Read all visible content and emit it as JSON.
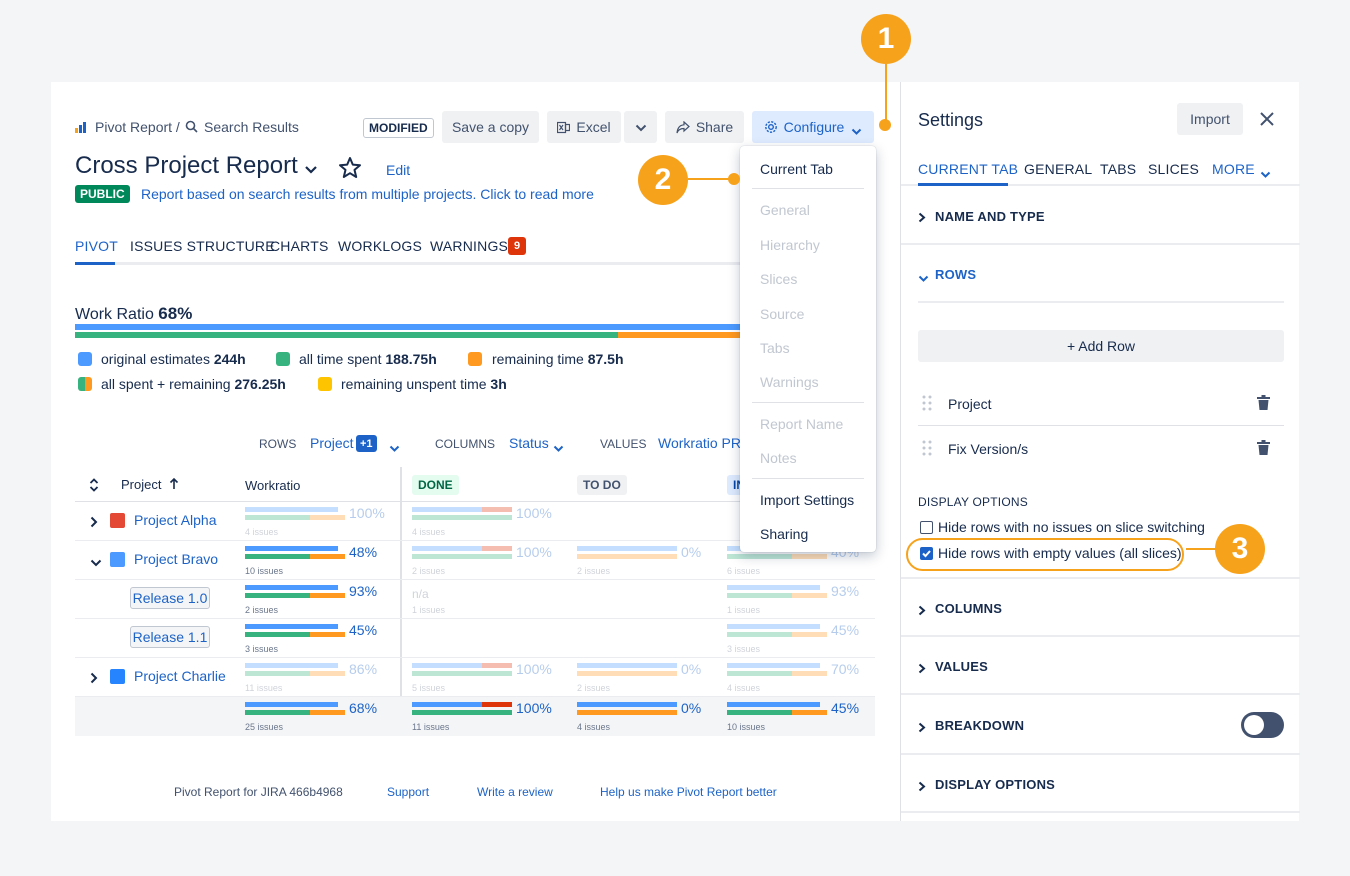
{
  "breadcrumb": {
    "part1": "Pivot Report /",
    "part2": "Search Results"
  },
  "header": {
    "modified_badge": "MODIFIED",
    "save_copy": "Save a copy",
    "excel": "Excel",
    "share": "Share",
    "configure": "Configure",
    "title": "Cross Project Report",
    "edit": "Edit",
    "public_badge": "PUBLIC",
    "description": "Report based on search results from multiple projects. Click to read more"
  },
  "tabs": [
    {
      "label": "PIVOT"
    },
    {
      "label": "ISSUES STRUCTURE"
    },
    {
      "label": "CHARTS"
    },
    {
      "label": "WORKLOGS"
    },
    {
      "label": "WARNINGS",
      "badge": "9"
    }
  ],
  "work_ratio": {
    "label": "Work Ratio",
    "value": "68%"
  },
  "legend": [
    {
      "text": "original estimates",
      "value": "244h",
      "color": "#4c9aff"
    },
    {
      "text": "all time spent",
      "value": "188.75h",
      "color": "#36b37e"
    },
    {
      "text": "remaining time",
      "value": "87.5h",
      "color": "#ff991f"
    },
    {
      "text": "all spent + remaining",
      "value": "276.25h",
      "color": "#36b37e"
    },
    {
      "text": "remaining unspent time",
      "value": "3h",
      "color": "#ffc400"
    }
  ],
  "controls": {
    "rows_label": "ROWS",
    "rows_value": "Project",
    "rows_badge": "+1",
    "columns_label": "COLUMNS",
    "columns_value": "Status",
    "values_label": "VALUES",
    "values_value": "Workratio PR"
  },
  "table": {
    "headers": {
      "project": "Project",
      "workratio": "Workratio",
      "done": "DONE",
      "todo": "TO DO",
      "inprogress": "IN"
    },
    "rows": [
      {
        "name": "Project Alpha",
        "wr": "100%",
        "wr_issues": "4 issues",
        "done": "100%",
        "done_issues": "4 issues",
        "todo": "",
        "todo_issues": "",
        "ip": "",
        "ip_issues": ""
      },
      {
        "name": "Project Bravo",
        "wr": "48%",
        "wr_issues": "10 issues",
        "done": "100%",
        "done_issues": "2 issues",
        "todo": "0%",
        "todo_issues": "2 issues",
        "ip": "40%",
        "ip_issues": "6 issues"
      },
      {
        "name": "Release 1.0",
        "wr": "93%",
        "wr_issues": "2 issues",
        "done": "n/a",
        "done_issues": "1 issues",
        "todo": "",
        "todo_issues": "",
        "ip": "93%",
        "ip_issues": "1 issues"
      },
      {
        "name": "Release 1.1",
        "wr": "45%",
        "wr_issues": "3 issues",
        "done": "",
        "done_issues": "",
        "todo": "",
        "todo_issues": "",
        "ip": "45%",
        "ip_issues": "3 issues"
      },
      {
        "name": "Project Charlie",
        "wr": "86%",
        "wr_issues": "11 issues",
        "done": "100%",
        "done_issues": "5 issues",
        "todo": "0%",
        "todo_issues": "2 issues",
        "ip": "70%",
        "ip_issues": "4 issues"
      },
      {
        "name": "",
        "wr": "68%",
        "wr_issues": "25 issues",
        "done": "100%",
        "done_issues": "11 issues",
        "todo": "0%",
        "todo_issues": "4 issues",
        "ip": "45%",
        "ip_issues": "10 issues"
      }
    ]
  },
  "footer": {
    "version": "Pivot Report for JIRA 466b4968",
    "support": "Support",
    "review": "Write a review",
    "help": "Help us make Pivot Report better"
  },
  "menu": {
    "items": [
      "Current Tab",
      "General",
      "Hierarchy",
      "Slices",
      "Source",
      "Tabs",
      "Warnings",
      "Report Name",
      "Notes",
      "Import Settings",
      "Sharing"
    ]
  },
  "settings": {
    "title": "Settings",
    "import": "Import",
    "tabs": [
      "CURRENT TAB",
      "GENERAL",
      "TABS",
      "SLICES",
      "MORE"
    ],
    "sections": {
      "name_type": "NAME AND TYPE",
      "rows": "ROWS",
      "columns": "COLUMNS",
      "values": "VALUES",
      "breakdown": "BREAKDOWN",
      "display_options": "DISPLAY OPTIONS"
    },
    "add_row": "+ Add Row",
    "row_items": [
      "Project",
      "Fix Version/s"
    ],
    "display_options_label": "DISPLAY OPTIONS",
    "checkbox1": {
      "label": "Hide rows with no issues on slice switching",
      "checked": false
    },
    "checkbox2": {
      "label": "Hide rows with empty values (all slices)",
      "checked": true
    },
    "breakdown_toggle": false
  },
  "callouts": [
    "1",
    "2",
    "3"
  ]
}
